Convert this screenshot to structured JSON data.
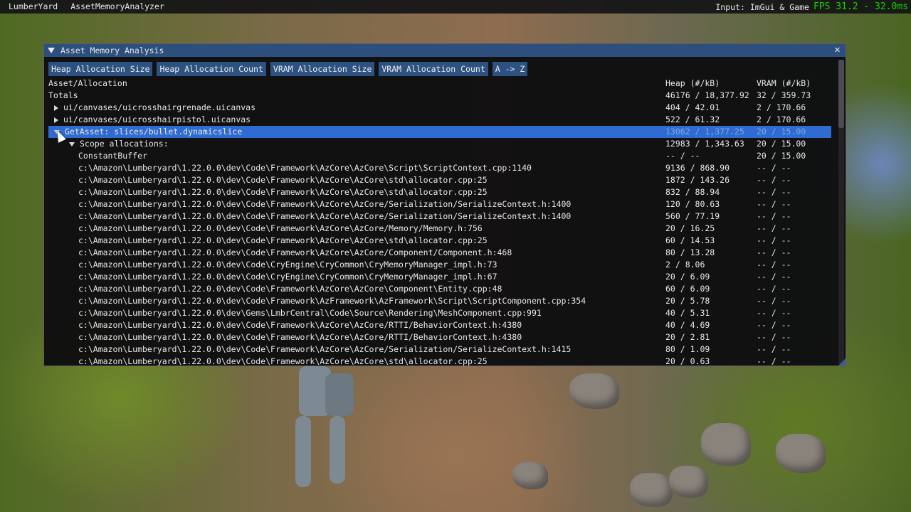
{
  "menubar": {
    "items": [
      "LumberYard",
      "AssetMemoryAnalyzer"
    ],
    "input_mode": "Input: ImGui & Game",
    "fps": "FPS 31.2 - 32.0ms"
  },
  "window": {
    "title": "Asset Memory Analysis",
    "close_icon": "close-icon",
    "sort_buttons": [
      "Heap Allocation Size",
      "Heap Allocation Count",
      "VRAM Allocation Size",
      "VRAM Allocation Count",
      "A -> Z"
    ]
  },
  "table": {
    "columns": [
      "Asset/Allocation",
      "Heap (#/kB)",
      "VRAM (#/kB)"
    ],
    "rows": [
      {
        "name": "Totals",
        "heap": "46176 / 18,377.92",
        "vram": "32 / 359.73"
      },
      {
        "name": "ui/canvases/uicrosshairgrenade.uicanvas",
        "heap": "404 / 42.01",
        "vram": "2 / 170.66"
      },
      {
        "name": "ui/canvases/uicrosshairpistol.uicanvas",
        "heap": "522 / 61.32",
        "vram": "2 / 170.66"
      },
      {
        "name": "GetAsset: slices/bullet.dynamicslice",
        "heap": "13062 / 1,377.25",
        "vram": "20 / 15.00"
      },
      {
        "name": "Scope allocations:",
        "heap": "12983 / 1,343.63",
        "vram": "20 / 15.00"
      },
      {
        "name": "ConstantBuffer",
        "heap": "-- / --",
        "vram": "20 / 15.00"
      },
      {
        "name": "c:\\Amazon\\Lumberyard\\1.22.0.0\\dev\\Code\\Framework\\AzCore\\AzCore\\Script\\ScriptContext.cpp:1140",
        "heap": "9136 / 868.90",
        "vram": "-- / --"
      },
      {
        "name": "c:\\Amazon\\Lumberyard\\1.22.0.0\\dev\\Code\\Framework\\AzCore\\AzCore\\std\\allocator.cpp:25",
        "heap": "1872 / 143.26",
        "vram": "-- / --"
      },
      {
        "name": "c:\\Amazon\\Lumberyard\\1.22.0.0\\dev\\Code\\Framework\\AzCore\\AzCore\\std\\allocator.cpp:25",
        "heap": "832 / 88.94",
        "vram": "-- / --"
      },
      {
        "name": "c:\\Amazon\\Lumberyard\\1.22.0.0\\dev\\Code\\Framework\\AzCore\\AzCore/Serialization/SerializeContext.h:1400",
        "heap": "120 / 80.63",
        "vram": "-- / --"
      },
      {
        "name": "c:\\Amazon\\Lumberyard\\1.22.0.0\\dev\\Code\\Framework\\AzCore\\AzCore/Serialization/SerializeContext.h:1400",
        "heap": "560 / 77.19",
        "vram": "-- / --"
      },
      {
        "name": "c:\\Amazon\\Lumberyard\\1.22.0.0\\dev\\Code\\Framework\\AzCore\\AzCore/Memory/Memory.h:756",
        "heap": "20 / 16.25",
        "vram": "-- / --"
      },
      {
        "name": "c:\\Amazon\\Lumberyard\\1.22.0.0\\dev\\Code\\Framework\\AzCore\\AzCore\\std\\allocator.cpp:25",
        "heap": "60 / 14.53",
        "vram": "-- / --"
      },
      {
        "name": "c:\\Amazon\\Lumberyard\\1.22.0.0\\dev\\Code\\Framework\\AzCore\\AzCore/Component/Component.h:468",
        "heap": "80 / 13.28",
        "vram": "-- / --"
      },
      {
        "name": "c:\\Amazon\\Lumberyard\\1.22.0.0\\dev\\Code\\CryEngine\\CryCommon\\CryMemoryManager_impl.h:73",
        "heap": "2 / 8.06",
        "vram": "-- / --"
      },
      {
        "name": "c:\\Amazon\\Lumberyard\\1.22.0.0\\dev\\Code\\CryEngine\\CryCommon\\CryMemoryManager_impl.h:67",
        "heap": "20 / 6.09",
        "vram": "-- / --"
      },
      {
        "name": "c:\\Amazon\\Lumberyard\\1.22.0.0\\dev\\Code\\Framework\\AzCore\\AzCore\\Component\\Entity.cpp:48",
        "heap": "60 / 6.09",
        "vram": "-- / --"
      },
      {
        "name": "c:\\Amazon\\Lumberyard\\1.22.0.0\\dev\\Code\\Framework\\AzFramework\\AzFramework\\Script\\ScriptComponent.cpp:354",
        "heap": "20 / 5.78",
        "vram": "-- / --"
      },
      {
        "name": "c:\\Amazon\\Lumberyard\\1.22.0.0\\dev\\Gems\\LmbrCentral\\Code\\Source\\Rendering\\MeshComponent.cpp:991",
        "heap": "40 / 5.31",
        "vram": "-- / --"
      },
      {
        "name": "c:\\Amazon\\Lumberyard\\1.22.0.0\\dev\\Code\\Framework\\AzCore\\AzCore/RTTI/BehaviorContext.h:4380",
        "heap": "40 / 4.69",
        "vram": "-- / --"
      },
      {
        "name": "c:\\Amazon\\Lumberyard\\1.22.0.0\\dev\\Code\\Framework\\AzCore\\AzCore/RTTI/BehaviorContext.h:4380",
        "heap": "20 / 2.81",
        "vram": "-- / --"
      },
      {
        "name": "c:\\Amazon\\Lumberyard\\1.22.0.0\\dev\\Code\\Framework\\AzCore\\AzCore/Serialization/SerializeContext.h:1415",
        "heap": "80 / 1.09",
        "vram": "-- / --"
      },
      {
        "name": "c:\\Amazon\\Lumberyard\\1.22.0.0\\dev\\Code\\Framework\\AzCore\\AzCore\\std\\allocator.cpp:25",
        "heap": "20 / 0.63",
        "vram": "-- / --"
      }
    ]
  },
  "colors": {
    "title_bar": "#2c4f7e",
    "button": "#2d5282",
    "selected_row": "#2f6bd0",
    "fps_text": "#19d000"
  }
}
